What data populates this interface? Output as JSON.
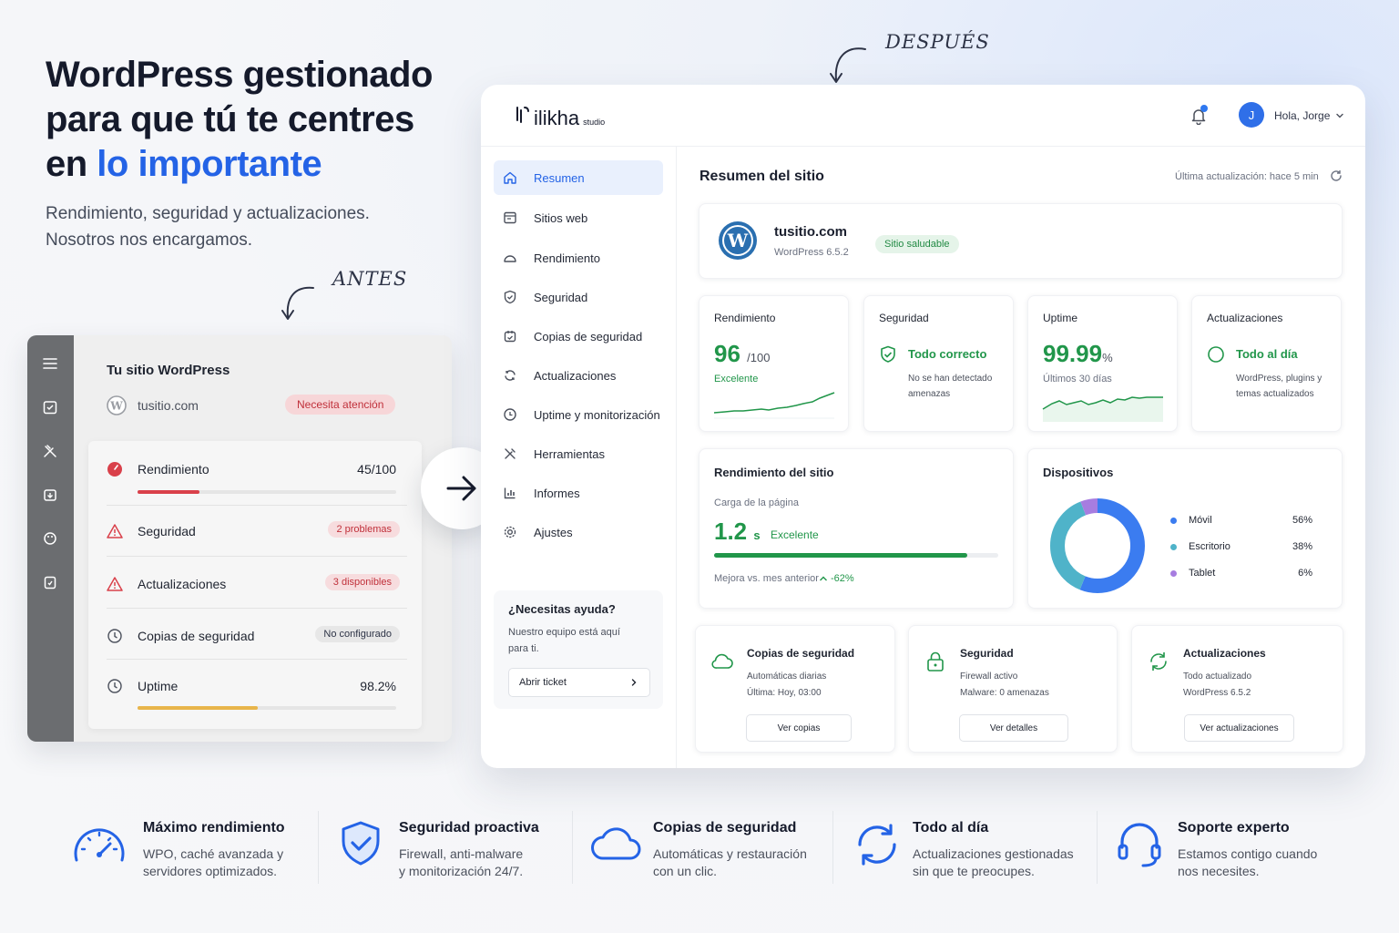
{
  "hero": {
    "title_line1": "WordPress gestionado",
    "title_line2": "para que tú te centres",
    "title_line3_pre": "en ",
    "title_line3_accent": "lo importante",
    "subtitle_line1": "Rendimiento, seguridad y actualizaciones.",
    "subtitle_line2": "Nosotros nos encargamos.",
    "accent_color": "#2463e6"
  },
  "labels": {
    "before": "ANTES",
    "after": "DESPUÉS"
  },
  "before": {
    "title": "Tu sitio WordPress",
    "site": "tusitio.com",
    "badge": "Necesita atención",
    "rows": [
      {
        "label": "Rendimiento",
        "value": "45/100",
        "progress": 0.24
      },
      {
        "label": "Seguridad",
        "pill": "2 problemas"
      },
      {
        "label": "Actualizaciones",
        "pill": "3 disponibles"
      },
      {
        "label": "Copias de seguridad",
        "pill": "No configurado"
      },
      {
        "label": "Uptime",
        "value": "98.2%",
        "progress": 0.465
      }
    ]
  },
  "dashboard": {
    "logo": "ilikha",
    "logo_suffix": "studio",
    "user_initial": "J",
    "greeting": "Hola, Jorge",
    "nav": [
      "Resumen",
      "Sitios web",
      "Rendimiento",
      "Seguridad",
      "Copias de seguridad",
      "Actualizaciones",
      "Uptime y monitorización",
      "Herramientas",
      "Informes",
      "Ajustes"
    ],
    "help": {
      "title": "¿Necesitas ayuda?",
      "desc": "Nuestro equipo está aquí para ti.",
      "button": "Abrir ticket"
    },
    "main_title": "Resumen del sitio",
    "last_update": "Última actualización: hace 5 min",
    "site": {
      "name": "tusitio.com",
      "version": "WordPress 6.5.2",
      "badge": "Sitio saludable"
    },
    "metrics": {
      "performance": {
        "label": "Rendimiento",
        "value": "96",
        "suffix": "/100",
        "sub": "Excelente"
      },
      "security": {
        "label": "Seguridad",
        "status": "Todo correcto",
        "desc": "No se han detectado amenazas"
      },
      "uptime": {
        "label": "Uptime",
        "value": "99.99",
        "suffix": "%",
        "sub": "Últimos 30 días"
      },
      "updates": {
        "label": "Actualizaciones",
        "status": "Todo al día",
        "desc": "WordPress, plugins y temas actualizados"
      }
    },
    "site_performance": {
      "title": "Rendimiento del sitio",
      "sub": "Carga de la página",
      "value": "1.2",
      "unit": "s",
      "status": "Excelente",
      "progress": 0.89,
      "improvement_label": "Mejora vs. mes anterior",
      "improvement": "-62%"
    },
    "devices": {
      "title": "Dispositivos",
      "items": [
        {
          "name": "Móvil",
          "value": "56%",
          "pct": 56,
          "color": "#3b7cf0"
        },
        {
          "name": "Escritorio",
          "value": "38%",
          "pct": 38,
          "color": "#4fb3c9"
        },
        {
          "name": "Tablet",
          "value": "6%",
          "pct": 6,
          "color": "#a77de0"
        }
      ]
    },
    "bottom": [
      {
        "title": "Copias de seguridad",
        "l1": "Automáticas diarias",
        "l2": "Última: Hoy, 03:00",
        "button": "Ver copias"
      },
      {
        "title": "Seguridad",
        "l1": "Firewall activo",
        "l2": "Malware: 0 amenazas",
        "button": "Ver detalles"
      },
      {
        "title": "Actualizaciones",
        "l1": "Todo actualizado",
        "l2": "WordPress 6.5.2",
        "button": "Ver actualizaciones"
      }
    ]
  },
  "features": [
    {
      "title": "Máximo rendimiento",
      "l1": "WPO, caché avanzada y",
      "l2": "servidores optimizados."
    },
    {
      "title": "Seguridad proactiva",
      "l1": "Firewall, anti-malware",
      "l2": "y monitorización 24/7."
    },
    {
      "title": "Copias de seguridad",
      "l1": "Automáticas y restauración",
      "l2": "con un clic."
    },
    {
      "title": "Todo al día",
      "l1": "Actualizaciones gestionadas",
      "l2": "sin que te preocupes."
    },
    {
      "title": "Soporte experto",
      "l1": "Estamos contigo cuando",
      "l2": "nos necesites."
    }
  ],
  "colors": {
    "blue": "#2463e6",
    "green": "#21964a",
    "red": "#d9404a",
    "amber": "#e8b54a"
  }
}
